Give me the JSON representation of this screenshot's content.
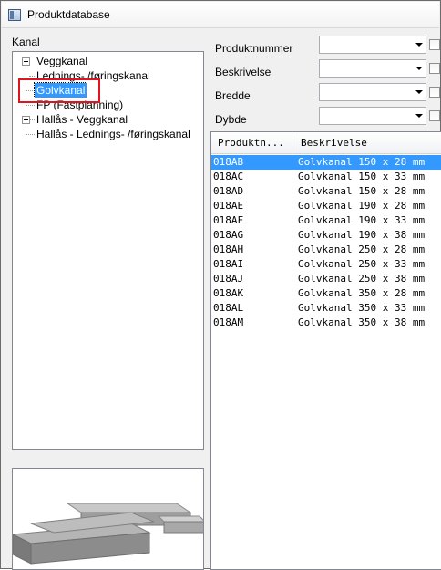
{
  "window": {
    "title": "Produktdatabase",
    "icon": "window-app-icon"
  },
  "tree": {
    "label": "Kanal",
    "nodes": [
      {
        "label": "Veggkanal",
        "expandable": true
      },
      {
        "label": "Lednings- /føringskanal",
        "expandable": false
      },
      {
        "label": "Golvkanal",
        "expandable": false,
        "selected": true
      },
      {
        "label": "FP (Fastplanning)",
        "expandable": false
      },
      {
        "label": "Hallås - Veggkanal",
        "expandable": true
      },
      {
        "label": "Hallås - Lednings- /føringskanal",
        "expandable": false
      }
    ]
  },
  "filters": [
    {
      "label": "Produktnummer",
      "value": ""
    },
    {
      "label": "Beskrivelse",
      "value": ""
    },
    {
      "label": "Bredde",
      "value": ""
    },
    {
      "label": "Dybde",
      "value": ""
    }
  ],
  "list": {
    "columns": [
      "Produktn...",
      "Beskrivelse"
    ],
    "rows": [
      [
        "018AB",
        "Golvkanal 150 x 28 mm"
      ],
      [
        "018AC",
        "Golvkanal 150 x 33 mm"
      ],
      [
        "018AD",
        "Golvkanal 150 x 28 mm"
      ],
      [
        "018AE",
        "Golvkanal 190 x 28 mm"
      ],
      [
        "018AF",
        "Golvkanal 190 x 33 mm"
      ],
      [
        "018AG",
        "Golvkanal 190 x 38 mm"
      ],
      [
        "018AH",
        "Golvkanal 250 x 28 mm"
      ],
      [
        "018AI",
        "Golvkanal 250 x 33 mm"
      ],
      [
        "018AJ",
        "Golvkanal 250 x 38 mm"
      ],
      [
        "018AK",
        "Golvkanal 350 x 28 mm"
      ],
      [
        "018AL",
        "Golvkanal 350 x 33 mm"
      ],
      [
        "018AM",
        "Golvkanal 350 x 38 mm"
      ]
    ],
    "selected_row": 0
  },
  "colors": {
    "selection": "#3399ff",
    "highlight_box": "#e0141e"
  }
}
